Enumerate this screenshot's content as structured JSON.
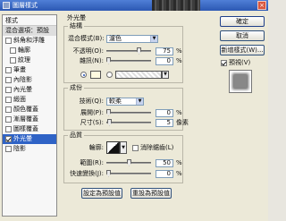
{
  "window": {
    "title": "圖層樣式"
  },
  "style_list": {
    "header": "樣式",
    "items": [
      {
        "label": "混合選項：預設",
        "checkbox": false,
        "checked": false,
        "sub": false,
        "selected": false,
        "header": true
      },
      {
        "label": "斜角和浮雕",
        "checkbox": true,
        "checked": false,
        "sub": false,
        "selected": false
      },
      {
        "label": "輪廓",
        "checkbox": true,
        "checked": false,
        "sub": true,
        "selected": false
      },
      {
        "label": "紋理",
        "checkbox": true,
        "checked": false,
        "sub": true,
        "selected": false
      },
      {
        "label": "筆畫",
        "checkbox": true,
        "checked": false,
        "sub": false,
        "selected": false
      },
      {
        "label": "內陰影",
        "checkbox": true,
        "checked": false,
        "sub": false,
        "selected": false
      },
      {
        "label": "內光暈",
        "checkbox": true,
        "checked": false,
        "sub": false,
        "selected": false
      },
      {
        "label": "緞面",
        "checkbox": true,
        "checked": false,
        "sub": false,
        "selected": false
      },
      {
        "label": "顏色覆蓋",
        "checkbox": true,
        "checked": false,
        "sub": false,
        "selected": false
      },
      {
        "label": "漸層覆蓋",
        "checkbox": true,
        "checked": false,
        "sub": false,
        "selected": false
      },
      {
        "label": "圖樣覆蓋",
        "checkbox": true,
        "checked": false,
        "sub": false,
        "selected": false
      },
      {
        "label": "外光暈",
        "checkbox": true,
        "checked": true,
        "sub": false,
        "selected": true
      },
      {
        "label": "陰影",
        "checkbox": true,
        "checked": false,
        "sub": false,
        "selected": false
      }
    ]
  },
  "panel": {
    "title": "外光暈",
    "structure": {
      "title": "結構",
      "blend_mode_label": "混合模式(B):",
      "blend_mode_value": "濾色",
      "opacity_label": "不透明(O):",
      "opacity_value": "75",
      "opacity_fraction": 0.75,
      "noise_label": "雜訊(N):",
      "noise_value": "0",
      "noise_fraction": 0,
      "percent": "%"
    },
    "elements": {
      "title": "成份",
      "technique_label": "技術(Q):",
      "technique_value": "較柔",
      "spread_label": "展開(P):",
      "spread_value": "0",
      "spread_fraction": 0,
      "size_label": "尺寸(S):",
      "size_value": "5",
      "size_fraction": 0.02,
      "percent": "%",
      "pixels": "像素"
    },
    "quality": {
      "title": "品質",
      "contour_label": "輪廓:",
      "antialias_label": "消除鋸齒(L)",
      "range_label": "範圍(R):",
      "range_value": "50",
      "range_fraction": 0.5,
      "jitter_label": "快速變換(J):",
      "jitter_value": "0",
      "jitter_fraction": 0,
      "percent": "%"
    },
    "make_default": "設定為預設值",
    "reset_default": "重設為預設值"
  },
  "right": {
    "ok": "確定",
    "cancel": "取消",
    "new_style": "新增樣式(W)...",
    "preview_label": "預視(V)",
    "preview_checked": true
  },
  "icons": {
    "dropdown": "chevron-down-icon",
    "close": "close-icon",
    "app": "photoshop-app-icon"
  },
  "colors": {
    "glow_color": "#fffbe0",
    "selection": "#2f63c6",
    "titlebar": "#2c58b3"
  }
}
